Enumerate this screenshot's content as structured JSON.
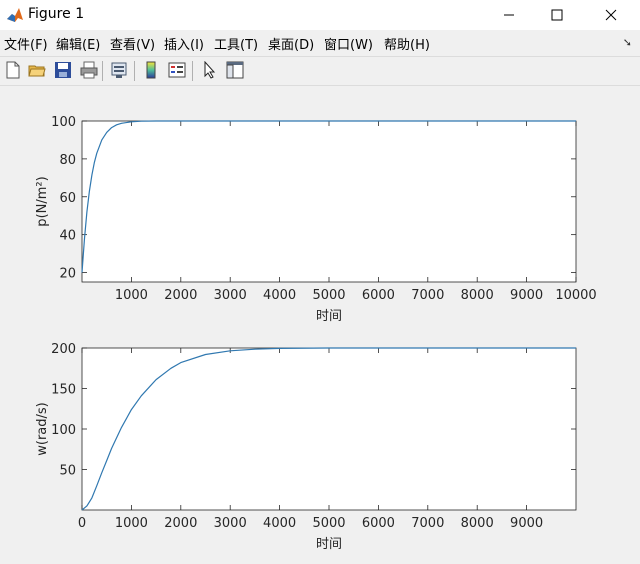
{
  "window": {
    "title": "Figure 1"
  },
  "menu": [
    "文件(F)",
    "编辑(E)",
    "查看(V)",
    "插入(I)",
    "工具(T)",
    "桌面(D)",
    "窗口(W)",
    "帮助(H)"
  ],
  "toolbar": {
    "icons": [
      "new-figure-icon",
      "open-file-icon",
      "save-icon",
      "print-icon",
      "link-plot-icon",
      "colorbar-icon",
      "legend-icon",
      "pointer-icon",
      "property-editor-icon"
    ]
  },
  "colors": {
    "line": "#3078b0",
    "axes_bg": "#ffffff",
    "figure_bg": "#f0f0f0"
  },
  "chart_data": [
    {
      "type": "line",
      "xlabel": "时间",
      "ylabel": "p(N/m²)",
      "xlim": [
        0,
        10000
      ],
      "ylim": [
        15,
        100
      ],
      "xticks": [
        1000,
        2000,
        3000,
        4000,
        5000,
        6000,
        7000,
        8000,
        9000,
        10000
      ],
      "xtick_labels": [
        "1000",
        "2000",
        "3000",
        "4000",
        "5000",
        "6000",
        "7000",
        "8000",
        "9000",
        "10000"
      ],
      "yticks": [
        20,
        40,
        60,
        80,
        100
      ],
      "ytick_labels": [
        "20",
        "40",
        "60",
        "80",
        "100"
      ],
      "series": [
        {
          "x": [
            0,
            50,
            100,
            150,
            200,
            250,
            300,
            400,
            500,
            600,
            700,
            800,
            1000,
            1200,
            1500,
            2000,
            3000,
            5000,
            10000
          ],
          "y": [
            20,
            38,
            52,
            63,
            71.5,
            78,
            83,
            90,
            94,
            96.5,
            98,
            98.8,
            99.6,
            99.9,
            100,
            100,
            100,
            100,
            100
          ]
        }
      ]
    },
    {
      "type": "line",
      "xlabel": "时间",
      "ylabel": "w(rad/s)",
      "xlim": [
        0,
        10000
      ],
      "ylim": [
        0,
        200
      ],
      "xticks": [
        0,
        1000,
        2000,
        3000,
        4000,
        5000,
        6000,
        7000,
        8000,
        9000
      ],
      "xtick_labels": [
        "0",
        "1000",
        "2000",
        "3000",
        "4000",
        "5000",
        "6000",
        "7000",
        "8000",
        "9000"
      ],
      "yticks": [
        50,
        100,
        150,
        200
      ],
      "ytick_labels": [
        "50",
        "100",
        "150",
        "200"
      ],
      "series": [
        {
          "x": [
            0,
            100,
            200,
            300,
            400,
            500,
            600,
            800,
            1000,
            1200,
            1500,
            1800,
            2000,
            2500,
            3000,
            3500,
            4000,
            5000,
            10000
          ],
          "y": [
            0,
            5,
            15,
            30,
            46,
            61,
            76,
            102,
            124,
            141,
            161,
            175,
            182,
            192,
            196.5,
            198.5,
            199.5,
            200,
            200
          ]
        }
      ]
    }
  ]
}
